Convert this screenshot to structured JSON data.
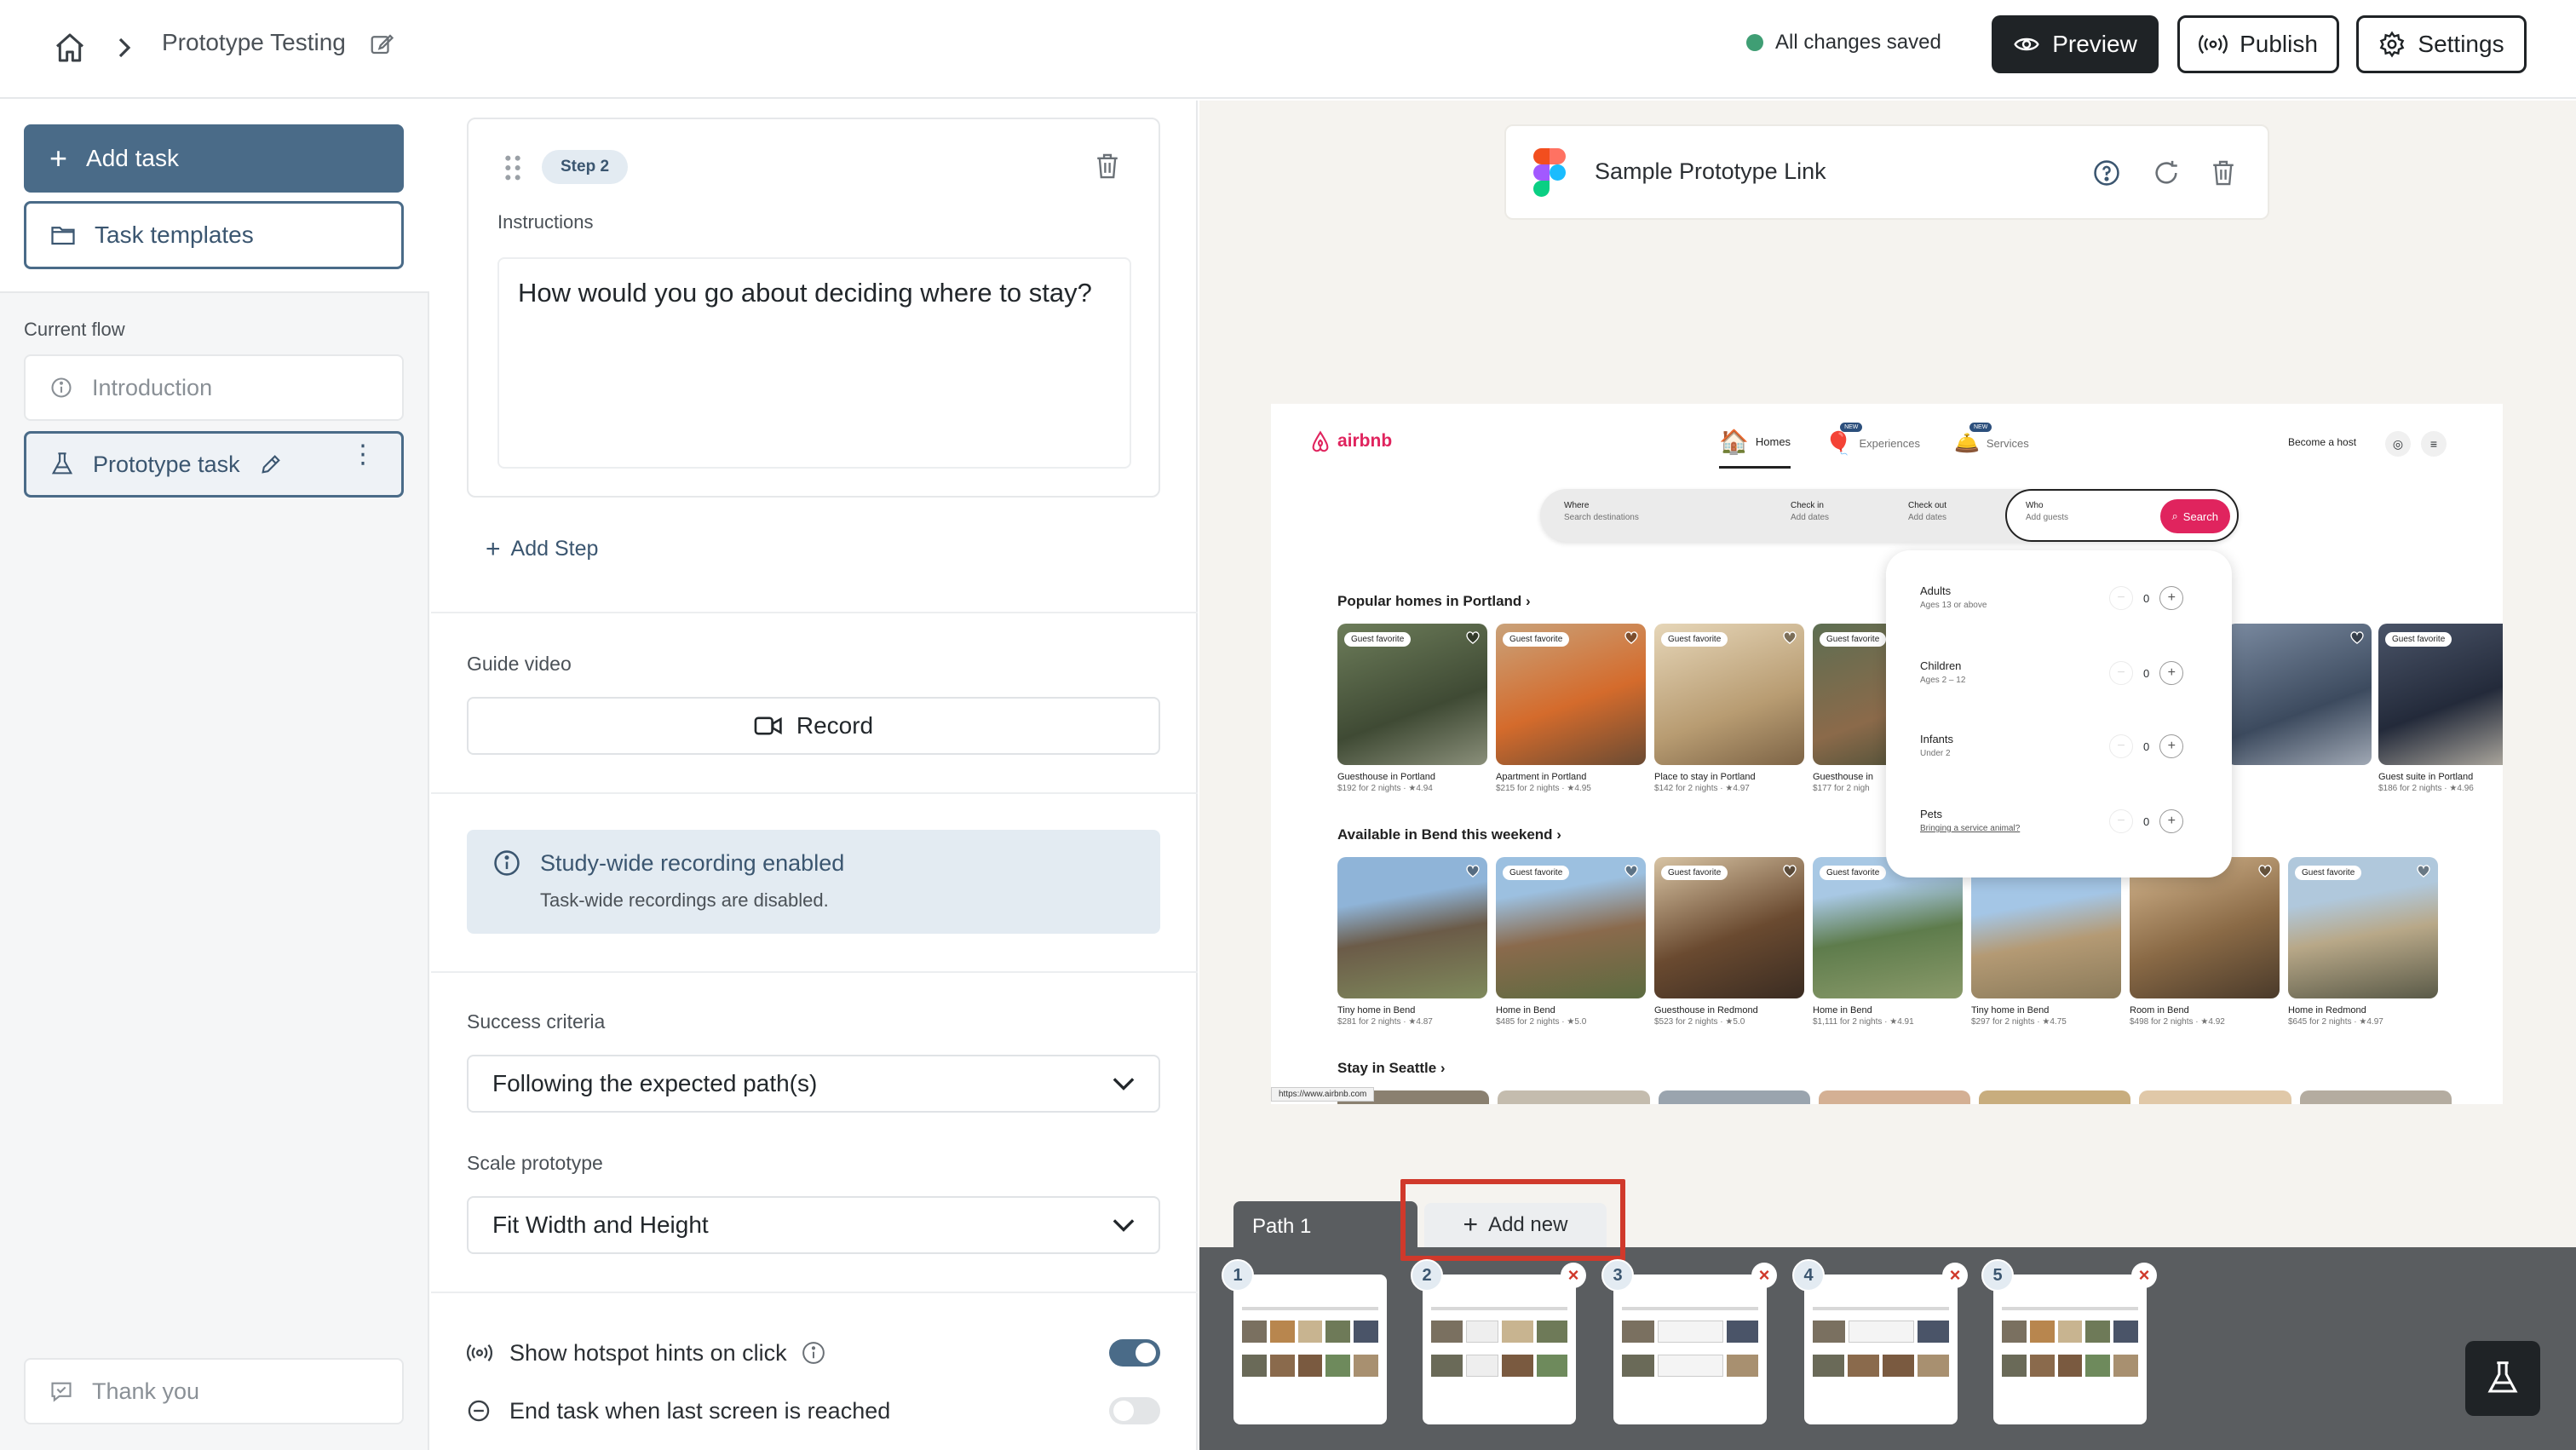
{
  "header": {
    "title": "Prototype Testing",
    "saved_status": "All changes saved",
    "preview_label": "Preview",
    "publish_label": "Publish",
    "settings_label": "Settings"
  },
  "sidebar": {
    "add_task_label": "Add task",
    "task_templates_label": "Task templates",
    "current_flow_label": "Current flow",
    "flow_items": [
      {
        "label": "Introduction"
      },
      {
        "label": "Prototype task"
      }
    ],
    "thank_you_label": "Thank you"
  },
  "editor": {
    "step_badge": "Step 2",
    "instructions_label": "Instructions",
    "instructions_text": "How would you go about deciding where to stay?",
    "add_step_label": "Add Step",
    "guide_video_label": "Guide video",
    "record_label": "Record",
    "info_title": "Study-wide recording enabled",
    "info_subtitle": "Task-wide recordings are disabled.",
    "success_criteria_label": "Success criteria",
    "success_criteria_value": "Following the expected path(s)",
    "scale_prototype_label": "Scale prototype",
    "scale_prototype_value": "Fit Width and Height",
    "hotspot_hints_label": "Show hotspot hints on click",
    "hotspot_hints_enabled": true,
    "end_task_label": "End task when last screen is reached",
    "end_task_enabled": false
  },
  "prototype": {
    "link_title": "Sample Prototype Link",
    "airbnb": {
      "logo_text": "airbnb",
      "nav": [
        "Homes",
        "Experiences",
        "Services"
      ],
      "new_badge": "NEW",
      "become_host": "Become a host",
      "search": {
        "where_label": "Where",
        "where_placeholder": "Search destinations",
        "checkin_label": "Check in",
        "checkin_placeholder": "Add dates",
        "checkout_label": "Check out",
        "checkout_placeholder": "Add dates",
        "who_label": "Who",
        "who_placeholder": "Add guests",
        "search_button": "Search"
      },
      "guests": [
        {
          "title": "Adults",
          "sub": "Ages 13 or above",
          "count": "0"
        },
        {
          "title": "Children",
          "sub": "Ages 2 – 12",
          "count": "0"
        },
        {
          "title": "Infants",
          "sub": "Under 2",
          "count": "0"
        },
        {
          "title": "Pets",
          "sub": "Bringing a service animal?",
          "count": "0"
        }
      ],
      "sections": [
        "Popular homes in Portland ›",
        "Available in Bend this weekend ›",
        "Stay in Seattle ›"
      ],
      "badge_text": "Guest favorite",
      "row1": [
        {
          "name": "Guesthouse in Portland",
          "meta": "$192 for 2 nights · ★4.94"
        },
        {
          "name": "Apartment in Portland",
          "meta": "$215 for 2 nights · ★4.95"
        },
        {
          "name": "Place to stay in Portland",
          "meta": "$142 for 2 nights · ★4.97"
        },
        {
          "name": "Guesthouse in",
          "meta": "$177 for 2 nigh"
        },
        {
          "name": "Guest suite in Portland",
          "meta": "$186 for 2 nights · ★4.96"
        }
      ],
      "row2": [
        {
          "name": "Tiny home in Bend",
          "meta": "$281 for 2 nights · ★4.87"
        },
        {
          "name": "Home in Bend",
          "meta": "$485 for 2 nights · ★5.0"
        },
        {
          "name": "Guesthouse in Redmond",
          "meta": "$523 for 2 nights · ★5.0"
        },
        {
          "name": "Home in Bend",
          "meta": "$1,111 for 2 nights · ★4.91"
        },
        {
          "name": "Tiny home in Bend",
          "meta": "$297 for 2 nights · ★4.75"
        },
        {
          "name": "Room in Bend",
          "meta": "$498 for 2 nights · ★4.92"
        },
        {
          "name": "Home in Redmond",
          "meta": "$645 for 2 nights · ★4.97"
        }
      ],
      "status_url": "https://www.airbnb.com"
    }
  },
  "paths": {
    "tab_label": "Path 1",
    "add_new_label": "Add new",
    "screens": [
      "1",
      "2",
      "3",
      "4",
      "5"
    ]
  },
  "colors": {
    "accent": "#4a6b88",
    "dark": "#1f2326",
    "saved_dot": "#3f9e74",
    "highlight": "#d0392b",
    "airbnb": "#e0245e"
  }
}
